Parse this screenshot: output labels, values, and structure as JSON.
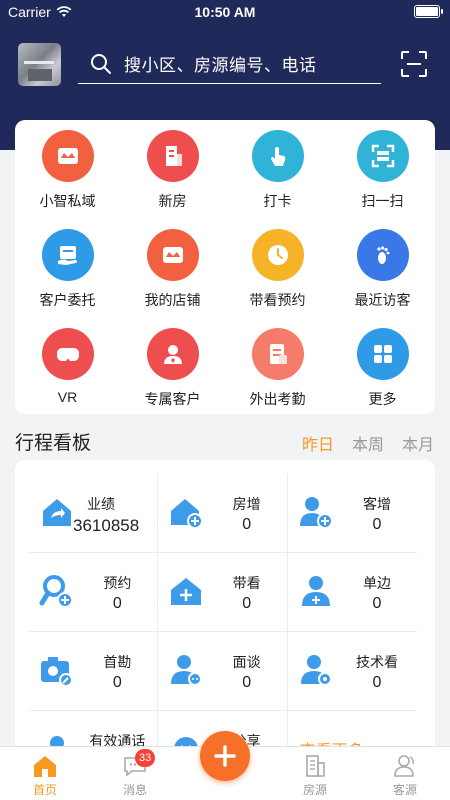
{
  "status_bar": {
    "carrier": "Carrier",
    "time": "10:50 AM"
  },
  "search": {
    "placeholder": "搜小区、房源编号、电话"
  },
  "menu": {
    "items": [
      {
        "label": "小智私域",
        "icon": "store-icon",
        "color": "#f2613f"
      },
      {
        "label": "新房",
        "icon": "building-icon",
        "color": "#ee4e4e"
      },
      {
        "label": "打卡",
        "icon": "tap-hand-icon",
        "color": "#2fb3d6"
      },
      {
        "label": "扫一扫",
        "icon": "scan-icon",
        "color": "#2fb3d6"
      },
      {
        "label": "客户委托",
        "icon": "handshake-icon",
        "color": "#2f9ae6"
      },
      {
        "label": "我的店铺",
        "icon": "store-icon",
        "color": "#f2613f"
      },
      {
        "label": "带看预约",
        "icon": "clock-icon",
        "color": "#f7b328"
      },
      {
        "label": "最近访客",
        "icon": "footprint-icon",
        "color": "#3b78e7"
      },
      {
        "label": "VR",
        "icon": "vr-goggles-icon",
        "color": "#ee4e4e"
      },
      {
        "label": "专属客户",
        "icon": "vip-user-icon",
        "color": "#ee4e4e"
      },
      {
        "label": "外出考勤",
        "icon": "attendance-icon",
        "color": "#f57b6b"
      },
      {
        "label": "更多",
        "icon": "grid-icon",
        "color": "#2f9ae6"
      }
    ]
  },
  "board": {
    "title": "行程看板",
    "tabs": [
      {
        "label": "昨日",
        "active": true
      },
      {
        "label": "本周",
        "active": false
      },
      {
        "label": "本月",
        "active": false
      }
    ],
    "stats": [
      {
        "label": "业绩",
        "value": "3610858",
        "icon": "house-share-icon"
      },
      {
        "label": "房增",
        "value": "0",
        "icon": "house-add-icon"
      },
      {
        "label": "客增",
        "value": "0",
        "icon": "user-add-icon"
      },
      {
        "label": "预约",
        "value": "0",
        "icon": "magnifier-add-icon"
      },
      {
        "label": "带看",
        "value": "0",
        "icon": "house-plus-icon"
      },
      {
        "label": "单边",
        "value": "0",
        "icon": "user-plus-icon"
      },
      {
        "label": "首勘",
        "value": "0",
        "icon": "camera-edit-icon"
      },
      {
        "label": "面谈",
        "value": "0",
        "icon": "user-chat-icon"
      },
      {
        "label": "技术看",
        "value": "0",
        "icon": "user-tech-icon"
      },
      {
        "label": "有效通话",
        "value": "",
        "icon": "phone-icon"
      },
      {
        "label": "分享",
        "value": "",
        "icon": "share-icon"
      }
    ],
    "more_label": "查看更多"
  },
  "tabbar": {
    "items": [
      {
        "label": "首页",
        "active": true,
        "icon": "home-icon"
      },
      {
        "label": "消息",
        "active": false,
        "icon": "message-icon"
      },
      {
        "label": "房源",
        "active": false,
        "icon": "building-icon"
      },
      {
        "label": "客源",
        "active": false,
        "icon": "customers-icon"
      }
    ],
    "badge": "33"
  },
  "colors": {
    "accent": "#f59a23",
    "header": "#1f2a5a",
    "stat_icon": "#3d9be9",
    "fab": "#f6702a"
  }
}
